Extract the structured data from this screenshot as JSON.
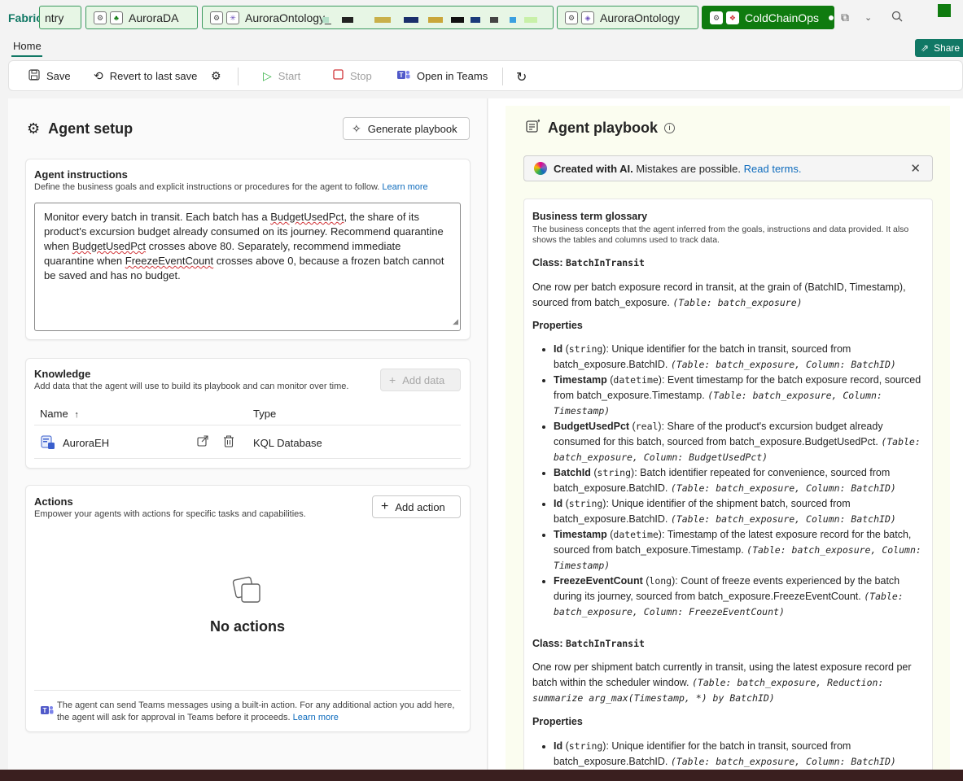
{
  "topbar": {
    "brand": "Fabric",
    "tabs": [
      {
        "label": "ntry",
        "active": false
      },
      {
        "label": "AuroraDA",
        "active": false
      },
      {
        "label": "AuroraOntology_",
        "active": false
      },
      {
        "label": "AuroraOntology",
        "active": false
      },
      {
        "label": "ColdChainOps",
        "active": true
      }
    ]
  },
  "nav": {
    "home_tab": "Home",
    "share_label": "Share"
  },
  "toolbar": {
    "save": "Save",
    "revert": "Revert to last save",
    "start": "Start",
    "stop": "Stop",
    "open_teams": "Open in Teams"
  },
  "agent_setup": {
    "title": "Agent setup",
    "generate_button": "Generate playbook",
    "instructions": {
      "title": "Agent instructions",
      "subtitle": "Define the business goals and explicit instructions or procedures for the agent to follow.",
      "learn_more": "Learn more",
      "text_parts": [
        "Monitor every batch in transit. Each batch has a ",
        "BudgetUsedPct",
        ", the share of its product's excursion budget already consumed on its journey. Recommend quarantine when ",
        "BudgetUsedPct",
        " crosses above 80. Separately, recommend immediate quarantine when ",
        "FreezeEventCount",
        " crosses above 0, because a frozen batch cannot be saved and has no budget."
      ]
    },
    "knowledge": {
      "title": "Knowledge",
      "subtitle": "Add data that the agent will use to build its playbook and can monitor over time.",
      "add_button": "Add data",
      "columns": {
        "name": "Name",
        "type": "Type"
      },
      "rows": [
        {
          "name": "AuroraEH",
          "type": "KQL Database"
        }
      ]
    },
    "actions": {
      "title": "Actions",
      "subtitle": "Empower your agents with actions for specific tasks and capabilities.",
      "add_button": "Add action",
      "empty_text": "No actions",
      "footnote": "The agent can send Teams messages using a built-in action. For any additional action you add here, the agent will ask for approval in Teams before it proceeds.",
      "learn_more": "Learn more"
    }
  },
  "playbook": {
    "title": "Agent playbook",
    "banner": {
      "bold": "Created with AI.",
      "text": "Mistakes are possible.",
      "link": "Read terms."
    },
    "glossary_title": "Business term glossary",
    "glossary_subtitle": "The business concepts that the agent inferred from the goals, instructions and data provided. It also shows the tables and columns used to track data.",
    "class_label": "Class:",
    "properties_label": "Properties",
    "classes": [
      {
        "name": "BatchInTransit",
        "desc": "One row per batch exposure record in transit, at the grain of (BatchID, Timestamp), sourced from batch_exposure.",
        "table_ref": "(Table: batch_exposure)",
        "properties": [
          {
            "name": "Id",
            "type": "string",
            "desc": "Unique identifier for the batch in transit, sourced from batch_exposure.BatchID.",
            "ref": "(Table: batch_exposure, Column: BatchID)"
          },
          {
            "name": "Timestamp",
            "type": "datetime",
            "desc": "Event timestamp for the batch exposure record, sourced from batch_exposure.Timestamp.",
            "ref": "(Table: batch_exposure, Column: Timestamp)"
          },
          {
            "name": "BudgetUsedPct",
            "type": "real",
            "desc": "Share of the product's excursion budget already consumed for this batch, sourced from batch_exposure.BudgetUsedPct.",
            "ref": "(Table: batch_exposure, Column: BudgetUsedPct)"
          },
          {
            "name": "BatchId",
            "type": "string",
            "desc": "Batch identifier repeated for convenience, sourced from batch_exposure.BatchID.",
            "ref": "(Table: batch_exposure, Column: BatchID)"
          },
          {
            "name": "Id",
            "type": "string",
            "desc": "Unique identifier of the shipment batch, sourced from batch_exposure.BatchID.",
            "ref": "(Table: batch_exposure, Column: BatchID)"
          },
          {
            "name": "Timestamp",
            "type": "datetime",
            "desc": "Timestamp of the latest exposure record for the batch, sourced from batch_exposure.Timestamp.",
            "ref": "(Table: batch_exposure, Column: Timestamp)"
          },
          {
            "name": "FreezeEventCount",
            "type": "long",
            "desc": "Count of freeze events experienced by the batch during its journey, sourced from batch_exposure.FreezeEventCount.",
            "ref": "(Table: batch_exposure, Column: FreezeEventCount)"
          }
        ]
      },
      {
        "name": "BatchInTransit",
        "desc": "One row per shipment batch currently in transit, using the latest exposure record per batch within the scheduler window.",
        "table_ref": "(Table: batch_exposure, Reduction: summarize arg_max(Timestamp, *) by BatchID)",
        "properties": [
          {
            "name": "Id",
            "type": "string",
            "desc": "Unique identifier for the batch in transit, sourced from batch_exposure.BatchID.",
            "ref": "(Table: batch_exposure, Column: BatchID)"
          }
        ]
      }
    ]
  }
}
